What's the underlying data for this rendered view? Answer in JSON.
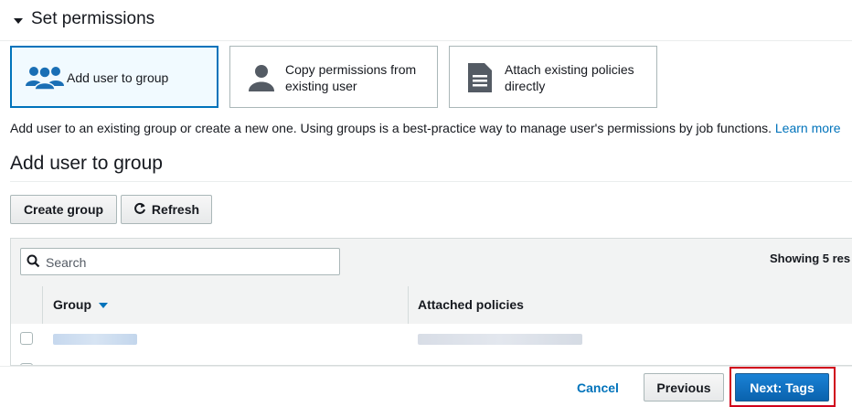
{
  "section": {
    "title": "Set permissions"
  },
  "options": [
    {
      "label": "Add user to group",
      "icon": "users-group-icon",
      "selected": true
    },
    {
      "label": "Copy permissions from existing user",
      "icon": "user-icon",
      "selected": false
    },
    {
      "label": "Attach existing policies directly",
      "icon": "document-icon",
      "selected": false
    }
  ],
  "description": {
    "text": "Add user to an existing group or create a new one. Using groups is a best-practice way to manage user's permissions by job functions.",
    "learn_more": "Learn more"
  },
  "subsection": {
    "title": "Add user to group"
  },
  "toolbar": {
    "create_group_label": "Create group",
    "refresh_label": "Refresh"
  },
  "table": {
    "search_placeholder": "Search",
    "showing_text": "Showing 5 res",
    "columns": [
      "Group",
      "Attached policies"
    ],
    "rows": [
      {
        "group": "(redacted)",
        "attached_policies": "(redacted)"
      },
      {
        "group": "(redacted)",
        "attached_policies": "(redacted)"
      }
    ]
  },
  "footer": {
    "cancel_label": "Cancel",
    "previous_label": "Previous",
    "next_label": "Next: Tags"
  },
  "colors": {
    "accent": "#0073bb",
    "highlight": "#d0021b",
    "selected_bg": "#f1faff"
  }
}
